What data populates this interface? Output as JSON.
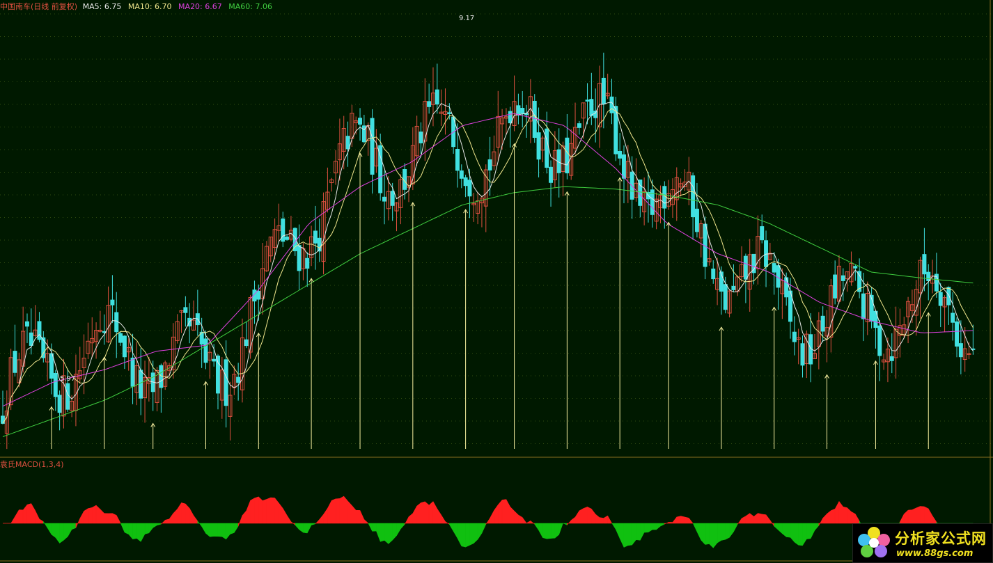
{
  "colors": {
    "background": "#001900",
    "up": "#e05040",
    "down": "#40e0e0",
    "ma5": "#e8e8e8",
    "ma10": "#f0e68c",
    "ma20": "#e040e0",
    "ma60": "#40d040",
    "arrow": "#f8f0a0",
    "macd_up": "#ff2020",
    "macd_down": "#10c010",
    "grid": "#304a10",
    "title": "#e05040",
    "label": "#e8e8e8"
  },
  "header": {
    "title": "中国南车(日线 前复权)",
    "ma5_label": "MA5:",
    "ma5_value": "6.75",
    "ma10_label": "MA10:",
    "ma10_value": "6.70",
    "ma20_label": "MA20:",
    "ma20_value": "6.67",
    "ma60_label": "MA60:",
    "ma60_value": "7.06"
  },
  "indicator": {
    "title": "袁氏MACD(1,3,4)"
  },
  "annotations": {
    "high": "9.17",
    "low": "5.97"
  },
  "watermark": {
    "title": "分析家公式网",
    "url": "www.88gs.com"
  },
  "chart_data": [
    {
      "type": "candlestick",
      "title": "中国南车(日线 前复权)",
      "high_label": 9.17,
      "low_label": 5.97,
      "ylim": [
        5.7,
        9.3
      ],
      "legend": [
        "MA5: 6.75",
        "MA10: 6.70",
        "MA20: 6.67",
        "MA60: 7.06"
      ],
      "ma60": [
        5.8,
        5.95,
        6.1,
        6.3,
        6.55,
        6.8,
        7.05,
        7.3,
        7.5,
        7.7,
        7.8,
        7.85,
        7.83,
        7.78,
        7.7,
        7.55,
        7.35,
        7.15,
        7.1,
        7.06
      ],
      "ma20": [
        6.05,
        6.25,
        6.35,
        6.5,
        6.55,
        7.0,
        7.55,
        7.85,
        8.05,
        8.35,
        8.45,
        8.35,
        8.0,
        7.55,
        7.3,
        7.15,
        6.9,
        6.75,
        6.65,
        6.67
      ],
      "buy_signal_count": 18
    },
    {
      "type": "area",
      "title": "袁氏MACD(1,3,4)",
      "series": [
        {
          "name": "up",
          "color": "red"
        },
        {
          "name": "down",
          "color": "green"
        }
      ]
    }
  ]
}
